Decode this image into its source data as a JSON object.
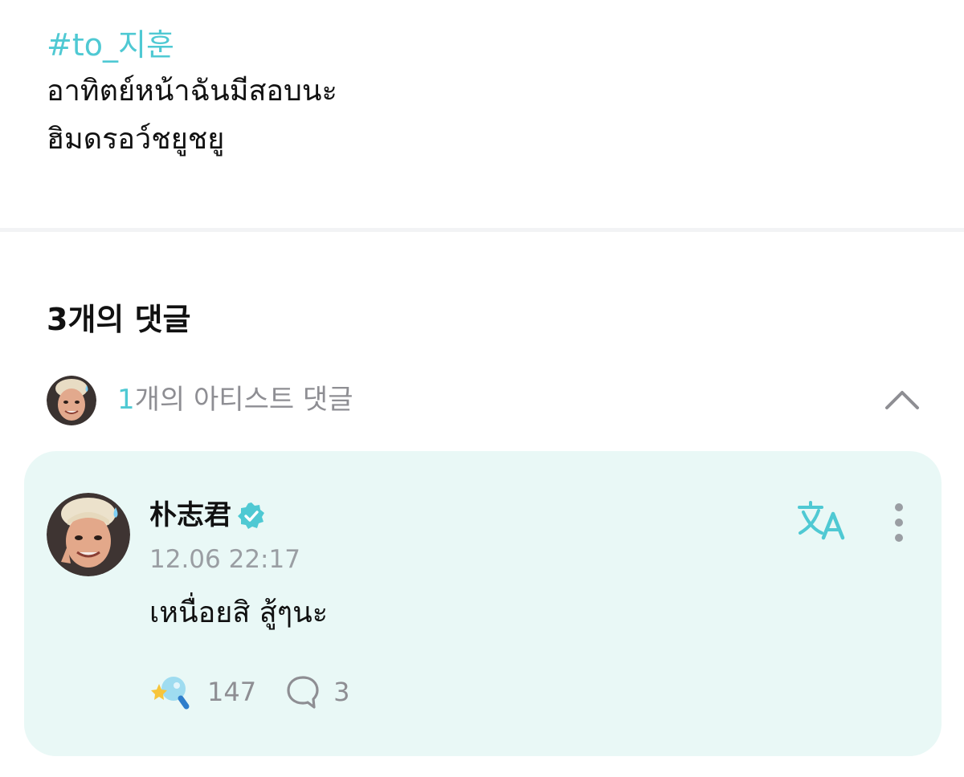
{
  "post": {
    "hashtag": "#to_지훈",
    "lines": [
      "อาทิตย์หน้าฉันมีสอบนะ",
      "ฮิมดรอว์ชยูชยู"
    ]
  },
  "comments": {
    "count_label": "3개의 댓글",
    "artist_summary": {
      "count": "1",
      "label": "개의 아티스트 댓글",
      "expanded": true
    }
  },
  "artist_comment": {
    "author": "朴志君",
    "verified": true,
    "timestamp": "12.06 22:17",
    "body": "เหนื่อยสิ สู้ๆนะ",
    "likes": "147",
    "replies": "3"
  },
  "icons": {
    "hashtag_color": "#4fc9d3",
    "accent": "#4fc9d3",
    "card_background": "#e9f8f6",
    "like": "star-magnifier-icon",
    "reply": "speech-bubble-icon",
    "translate": "translate-icon",
    "more": "kebab-menu-icon",
    "collapse": "chevron-up-icon"
  }
}
